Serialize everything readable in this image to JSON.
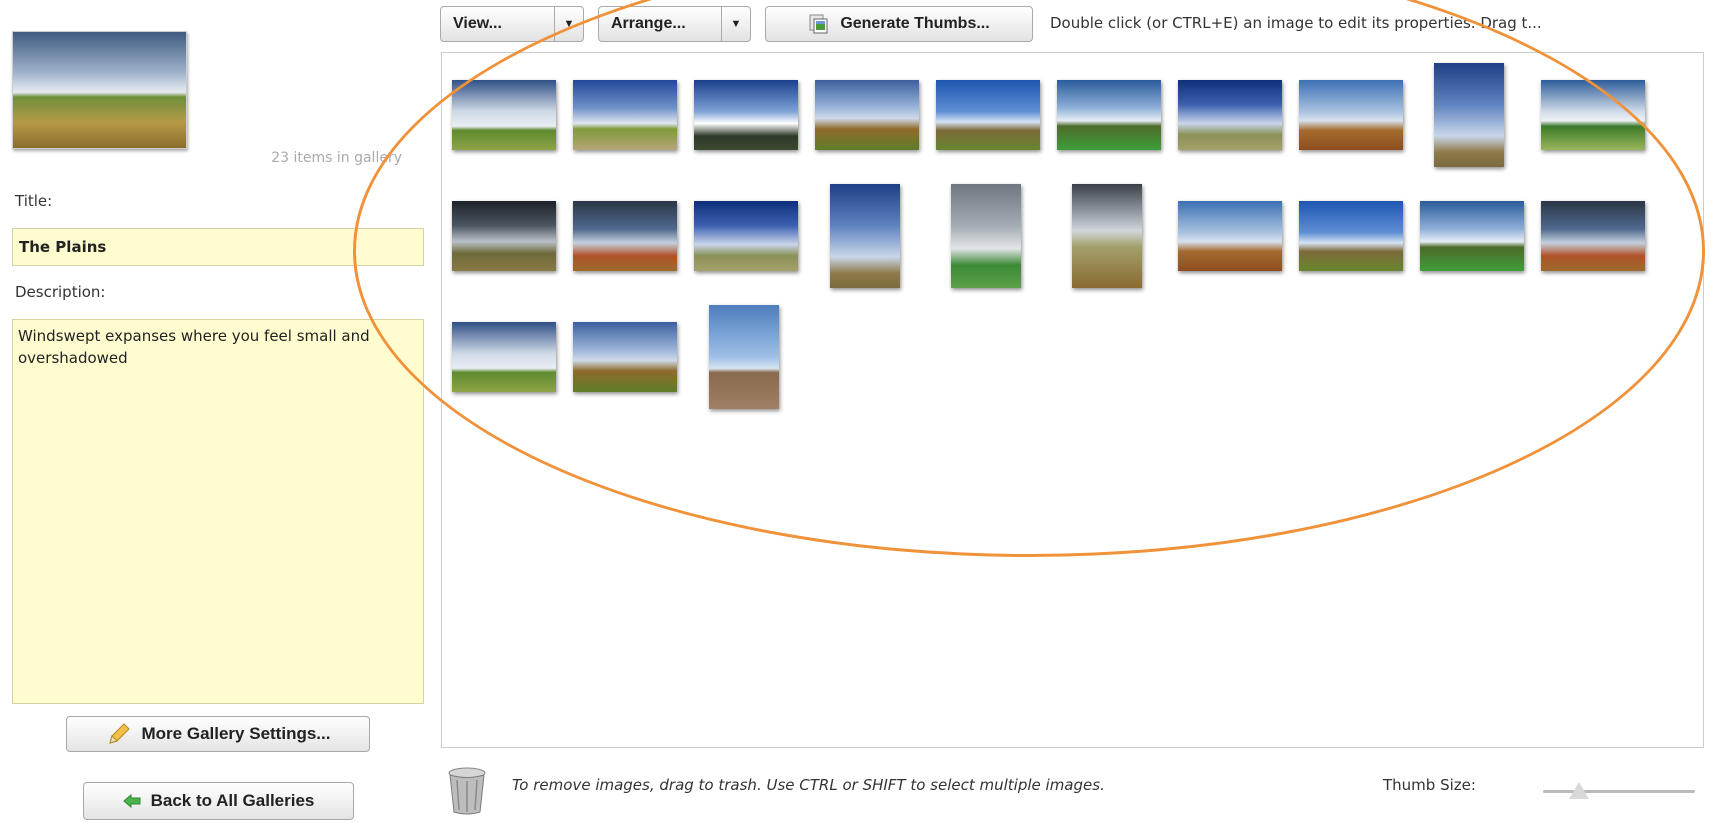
{
  "gallery": {
    "count_text": "23 items in gallery",
    "title_label": "Title:",
    "title_value": "The Plains",
    "description_label": "Description:",
    "description_value": "Windswept expanses where you feel small and overshadowed"
  },
  "buttons": {
    "more_settings": "More Gallery Settings...",
    "back": "Back to All Galleries",
    "settings_icon": "pencil-icon",
    "back_icon": "arrow-left-icon"
  },
  "toolbar": {
    "view_label": "View...",
    "arrange_label": "Arrange...",
    "generate_label": "Generate Thumbs...",
    "generate_icon": "thumbnails-icon",
    "hint": "Double click (or CTRL+E) an image to edit its properties.  Drag t..."
  },
  "footer": {
    "trash_icon": "trash-icon",
    "trash_hint": "To remove images, drag to trash.  Use CTRL or SHIFT to select multiple images.",
    "thumb_size_label": "Thumb Size:",
    "thumb_size_level": 0.2
  },
  "colors": {
    "annotation": "#f0923a",
    "field_background": "#fffdd0"
  }
}
